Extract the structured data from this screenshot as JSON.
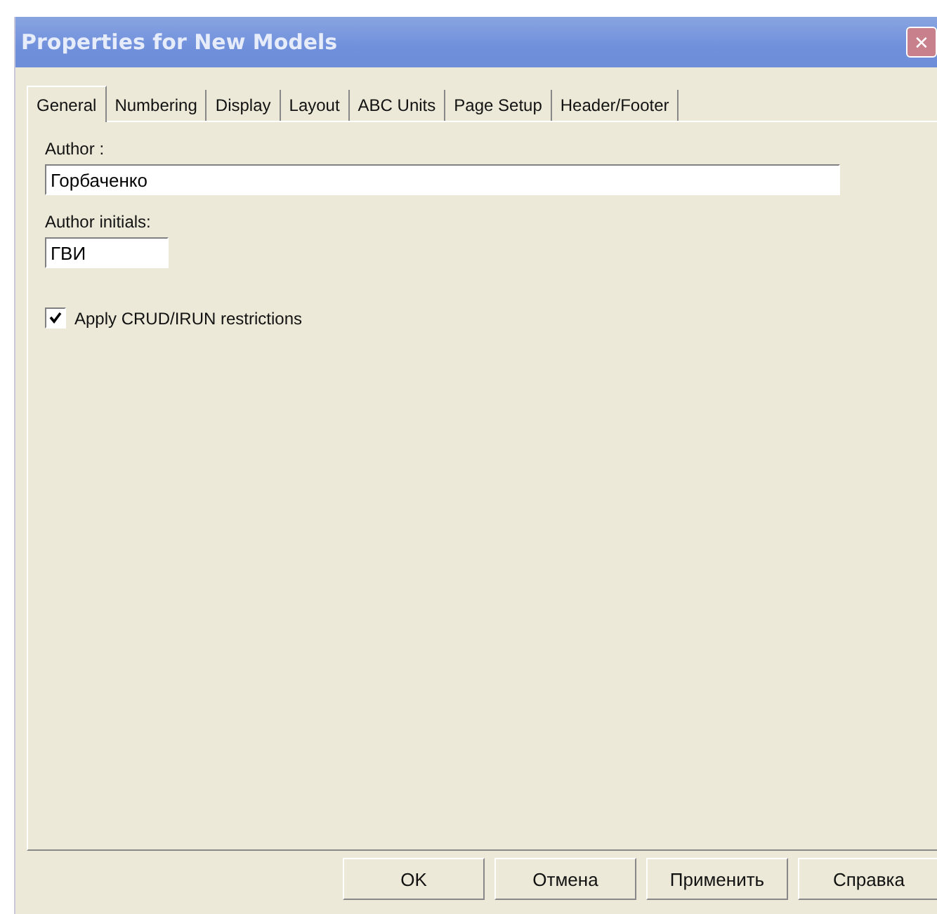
{
  "window": {
    "title": "Properties for New Models",
    "close": "✕"
  },
  "tabs": [
    {
      "label": "General",
      "selected": true
    },
    {
      "label": "Numbering",
      "selected": false
    },
    {
      "label": "Display",
      "selected": false
    },
    {
      "label": "Layout",
      "selected": false
    },
    {
      "label": "ABC Units",
      "selected": false
    },
    {
      "label": "Page Setup",
      "selected": false
    },
    {
      "label": "Header/Footer",
      "selected": false
    }
  ],
  "fields": [
    {
      "label": "Author :",
      "value": "Горбаченко",
      "kind": "wide"
    },
    {
      "label": "Author initials:",
      "value": "ГВИ",
      "kind": "short"
    }
  ],
  "checkbox": {
    "label": "Apply CRUD/IRUN restrictions",
    "checked": true
  },
  "buttons": [
    "OK",
    "Отмена",
    "Применить",
    "Справка"
  ]
}
